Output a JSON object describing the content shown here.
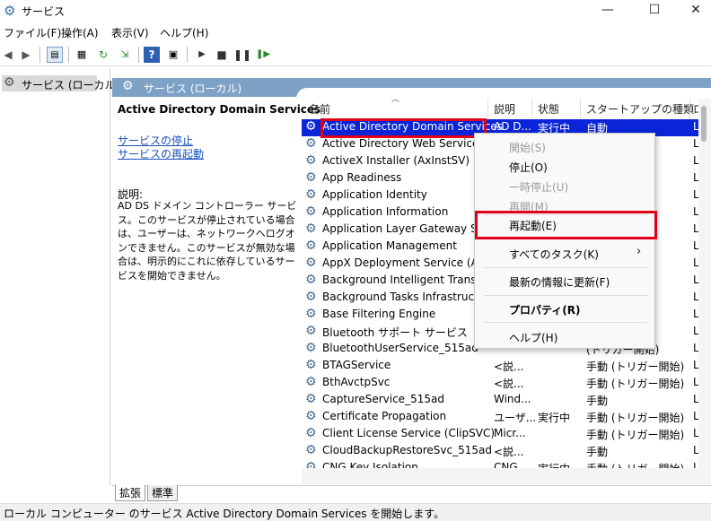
{
  "window": {
    "title": "サービス",
    "minimize": "—",
    "maximize": "☐",
    "close": "✕"
  },
  "menubar": [
    "ファイル(F)",
    "操作(A)",
    "表示(V)",
    "ヘルプ(H)"
  ],
  "tree": {
    "root_label": "サービス (ローカル)"
  },
  "pane": {
    "header": "サービス (ローカル)",
    "selected_service": "Active Directory Domain Services",
    "links": [
      "サービスの停止",
      "サービスの再起動"
    ],
    "description_label": "説明:",
    "description": "AD DS ドメイン コントローラー サービス。このサービスが停止されている場合は、ユーザーは、ネットワークへログオンできません。このサービスが無効な場合は、明示的にこれに依存しているサービスを開始できません。"
  },
  "columns": [
    "名前",
    "説明",
    "状態",
    "スタートアップの種類",
    "ロ"
  ],
  "rows": [
    {
      "name": "Active Directory Domain Services",
      "desc": "AD D...",
      "status": "実行中",
      "startup": "自動",
      "logon": "L"
    },
    {
      "name": "Active Directory Web Services",
      "desc": "",
      "status": "",
      "startup": "",
      "logon": "L"
    },
    {
      "name": "ActiveX Installer (AxInstSV)",
      "desc": "",
      "status": "",
      "startup": "",
      "logon": "L"
    },
    {
      "name": "App Readiness",
      "desc": "",
      "status": "",
      "startup": "",
      "logon": "L"
    },
    {
      "name": "Application Identity",
      "desc": "",
      "status": "",
      "startup": "始)",
      "logon": "L"
    },
    {
      "name": "Application Information",
      "desc": "",
      "status": "",
      "startup": "始)",
      "logon": "L"
    },
    {
      "name": "Application Layer Gateway Service",
      "desc": "",
      "status": "",
      "startup": "",
      "logon": "L"
    },
    {
      "name": "Application Management",
      "desc": "",
      "status": "",
      "startup": "",
      "logon": "L"
    },
    {
      "name": "AppX Deployment Service (AppX",
      "desc": "",
      "status": "",
      "startup": "始)",
      "logon": "L"
    },
    {
      "name": "Background Intelligent Transfer S",
      "desc": "",
      "status": "",
      "startup": "",
      "logon": "L"
    },
    {
      "name": "Background Tasks Infrastructure",
      "desc": "",
      "status": "",
      "startup": "",
      "logon": "L"
    },
    {
      "name": "Base Filtering Engine",
      "desc": "",
      "status": "",
      "startup": "",
      "logon": "L"
    },
    {
      "name": "Bluetooth サポート サービス",
      "desc": "",
      "status": "",
      "startup": "始)",
      "logon": "L"
    },
    {
      "name": "BluetoothUserService_515ad",
      "desc": "",
      "status": "",
      "startup": "(トリガー開始)",
      "logon": "L"
    },
    {
      "name": "BTAGService",
      "desc": "<説...",
      "status": "",
      "startup": "手動 (トリガー開始)",
      "logon": "L"
    },
    {
      "name": "BthAvctpSvc",
      "desc": "<説...",
      "status": "",
      "startup": "手動 (トリガー開始)",
      "logon": "L"
    },
    {
      "name": "CaptureService_515ad",
      "desc": "Wind...",
      "status": "",
      "startup": "手動",
      "logon": "L"
    },
    {
      "name": "Certificate Propagation",
      "desc": "ユーザ...",
      "status": "実行中",
      "startup": "手動 (トリガー開始)",
      "logon": "L"
    },
    {
      "name": "Client License Service (ClipSVC)",
      "desc": "Micr...",
      "status": "",
      "startup": "手動 (トリガー開始)",
      "logon": "L"
    },
    {
      "name": "CloudBackupRestoreSvc_515ad",
      "desc": "<説...",
      "status": "",
      "startup": "手動",
      "logon": "L"
    },
    {
      "name": "CNG Key Isolation",
      "desc": "CNG...",
      "status": "実行中",
      "startup": "手動 (トリガー開始)",
      "logon": "L"
    }
  ],
  "context_menu": {
    "start": "開始(S)",
    "stop": "停止(O)",
    "pause": "一時停止(U)",
    "resume": "再開(M)",
    "restart": "再起動(E)",
    "all_tasks": "すべてのタスク(K)",
    "refresh": "最新の情報に更新(F)",
    "properties": "プロパティ(R)",
    "help": "ヘルプ(H)"
  },
  "tabs": [
    "拡張",
    "標準"
  ],
  "status": "ローカル コンピューター のサービス Active Directory Domain Services を開始します。",
  "colors": {
    "header_blue": "#7da2c6",
    "selection": "#0a24d8",
    "highlight_red": "#e0001a",
    "link": "#1a4fbf"
  }
}
